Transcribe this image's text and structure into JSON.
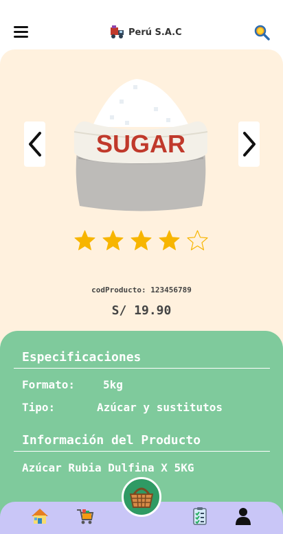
{
  "header": {
    "menu_icon": "hamburger-menu-icon",
    "brand_icon": "delivery-truck-icon",
    "title": "Perú S.A.C",
    "search_icon": "search-magnifier-icon"
  },
  "product": {
    "image": "sugar-sack-image",
    "image_label": "SUGAR",
    "prev_icon": "chevron-left-icon",
    "next_icon": "chevron-right-icon",
    "rating": 4,
    "rating_max": 5,
    "code_label": "codProducto: 123456789",
    "price": "S/ 19.90"
  },
  "specs": {
    "title": "Especificaciones",
    "rows": [
      {
        "label": "Formato:",
        "value": "5kg"
      },
      {
        "label": "Tipo:",
        "value": "Azúcar y sustitutos"
      }
    ]
  },
  "info": {
    "title": "Información del Producto",
    "description": "Azúcar Rubia Dulfina X 5KG"
  },
  "bottom_nav": {
    "items": [
      "home-icon",
      "shopping-cart-icon",
      "basket-icon",
      "clipboard-list-icon",
      "user-icon"
    ]
  },
  "colors": {
    "hero_bg": "#fff1de",
    "details_bg": "#7fca9c",
    "nav_bg": "#c9c6f7",
    "fab_bg": "#2f9a64",
    "star": "#f7b500"
  }
}
